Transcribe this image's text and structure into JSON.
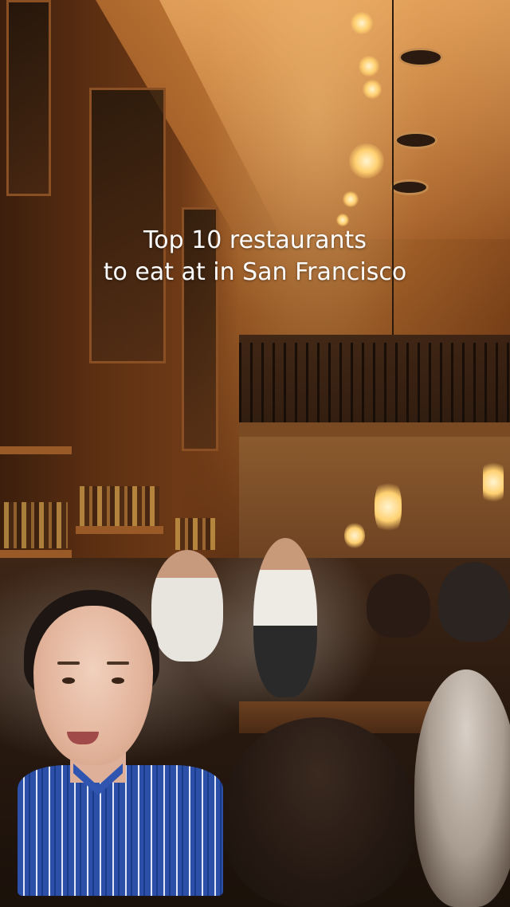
{
  "video": {
    "title_lines": [
      "Top 10 restaurants",
      "to eat at in San Francisco"
    ]
  },
  "colors": {
    "title_text": "#ffffff",
    "scene_warm": "#8c4d1e",
    "shirt_blue": "#2c4fa8"
  },
  "icons": {
    "creator_overlay": "person-facecam"
  }
}
